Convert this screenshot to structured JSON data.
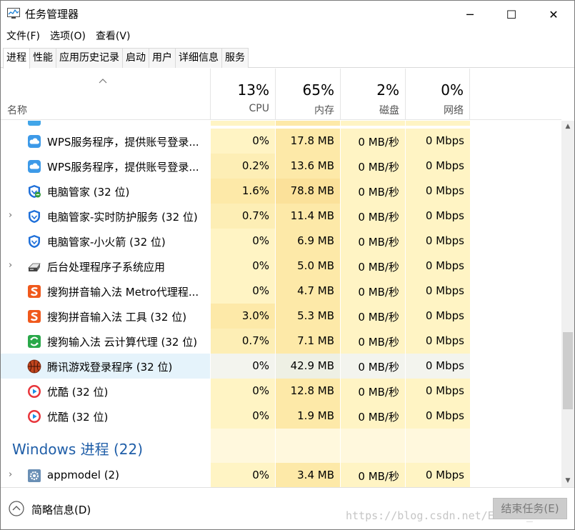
{
  "window": {
    "title": "任务管理器",
    "minimize_glyph": "─",
    "maximize_glyph": "☐",
    "close_glyph": "✕"
  },
  "menu": [
    "文件(F)",
    "选项(O)",
    "查看(V)"
  ],
  "tabs": [
    {
      "label": "进程",
      "active": true
    },
    {
      "label": "性能",
      "active": false
    },
    {
      "label": "应用历史记录",
      "active": false
    },
    {
      "label": "启动",
      "active": false
    },
    {
      "label": "用户",
      "active": false
    },
    {
      "label": "详细信息",
      "active": false
    },
    {
      "label": "服务",
      "active": false
    }
  ],
  "columns": {
    "name": "名称",
    "cpu": {
      "pct": "13%",
      "label": "CPU"
    },
    "mem": {
      "pct": "65%",
      "label": "内存"
    },
    "disk": {
      "pct": "2%",
      "label": "磁盘"
    },
    "net": {
      "pct": "0%",
      "label": "网络"
    }
  },
  "rows": [
    {
      "name": "WPS服务程序，提供账号登录...",
      "icon": "cloud-icon",
      "expandable": false,
      "cpu": "0%",
      "mem": "17.8 MB",
      "disk": "0 MB/秒",
      "net": "0 Mbps",
      "cpu_heat": "#fff4c4",
      "mem_heat": "#fde9a8"
    },
    {
      "name": "WPS服务程序，提供账号登录...",
      "icon": "cloud-icon",
      "expandable": false,
      "cpu": "0.2%",
      "mem": "13.6 MB",
      "disk": "0 MB/秒",
      "net": "0 Mbps",
      "cpu_heat": "#fdeeb5",
      "mem_heat": "#fde9a8"
    },
    {
      "name": "电脑管家 (32 位)",
      "icon": "shield-warning-icon",
      "expandable": false,
      "cpu": "1.6%",
      "mem": "78.8 MB",
      "disk": "0 MB/秒",
      "net": "0 Mbps",
      "cpu_heat": "#fde9a8",
      "mem_heat": "#fbe19a"
    },
    {
      "name": "电脑管家-实时防护服务 (32 位)",
      "icon": "shield-icon",
      "expandable": true,
      "cpu": "0.7%",
      "mem": "11.4 MB",
      "disk": "0 MB/秒",
      "net": "0 Mbps",
      "cpu_heat": "#fdeeb5",
      "mem_heat": "#fde9a8"
    },
    {
      "name": "电脑管家-小火箭 (32 位)",
      "icon": "shield-icon",
      "expandable": false,
      "cpu": "0%",
      "mem": "6.9 MB",
      "disk": "0 MB/秒",
      "net": "0 Mbps",
      "cpu_heat": "#fff4c4",
      "mem_heat": "#fde9a8"
    },
    {
      "name": "后台处理程序子系统应用",
      "icon": "printer-icon",
      "expandable": true,
      "cpu": "0%",
      "mem": "5.0 MB",
      "disk": "0 MB/秒",
      "net": "0 Mbps",
      "cpu_heat": "#fff4c4",
      "mem_heat": "#fde9a8"
    },
    {
      "name": "搜狗拼音输入法 Metro代理程...",
      "icon": "sogou-icon",
      "expandable": false,
      "cpu": "0%",
      "mem": "4.7 MB",
      "disk": "0 MB/秒",
      "net": "0 Mbps",
      "cpu_heat": "#fff4c4",
      "mem_heat": "#fde9a8"
    },
    {
      "name": "搜狗拼音输入法 工具 (32 位)",
      "icon": "sogou-icon",
      "expandable": false,
      "cpu": "3.0%",
      "mem": "5.3 MB",
      "disk": "0 MB/秒",
      "net": "0 Mbps",
      "cpu_heat": "#fde9a8",
      "mem_heat": "#fde9a8"
    },
    {
      "name": "搜狗输入法 云计算代理 (32 位)",
      "icon": "sogou-cloud-icon",
      "expandable": false,
      "cpu": "0.7%",
      "mem": "7.1 MB",
      "disk": "0 MB/秒",
      "net": "0 Mbps",
      "cpu_heat": "#fdeeb5",
      "mem_heat": "#fde9a8"
    },
    {
      "name": "腾讯游戏登录程序 (32 位)",
      "icon": "basketball-icon",
      "expandable": false,
      "cpu": "0%",
      "mem": "42.9 MB",
      "disk": "0 MB/秒",
      "net": "0 Mbps",
      "cpu_heat": "#f3f4ee",
      "mem_heat": "#eef0e4",
      "selected": true
    },
    {
      "name": "优酷 (32 位)",
      "icon": "youku-icon",
      "expandable": false,
      "cpu": "0%",
      "mem": "12.8 MB",
      "disk": "0 MB/秒",
      "net": "0 Mbps",
      "cpu_heat": "#fff4c4",
      "mem_heat": "#fde9a8"
    },
    {
      "name": "优酷 (32 位)",
      "icon": "youku-icon",
      "expandable": false,
      "cpu": "0%",
      "mem": "1.9 MB",
      "disk": "0 MB/秒",
      "net": "0 Mbps",
      "cpu_heat": "#fff4c4",
      "mem_heat": "#fde9a8"
    }
  ],
  "group": {
    "title": "Windows 进程 (22)"
  },
  "last_row": {
    "name": "appmodel (2)",
    "icon": "gear-icon",
    "expandable": true,
    "cpu": "0%",
    "mem": "3.4 MB",
    "disk": "0 MB/秒",
    "net": "0 Mbps"
  },
  "footer": {
    "toggle_label": "简略信息(D)",
    "end_task_label": "结束任务(E)",
    "watermark": "https://blog.csdn.net/Edison_ku"
  }
}
